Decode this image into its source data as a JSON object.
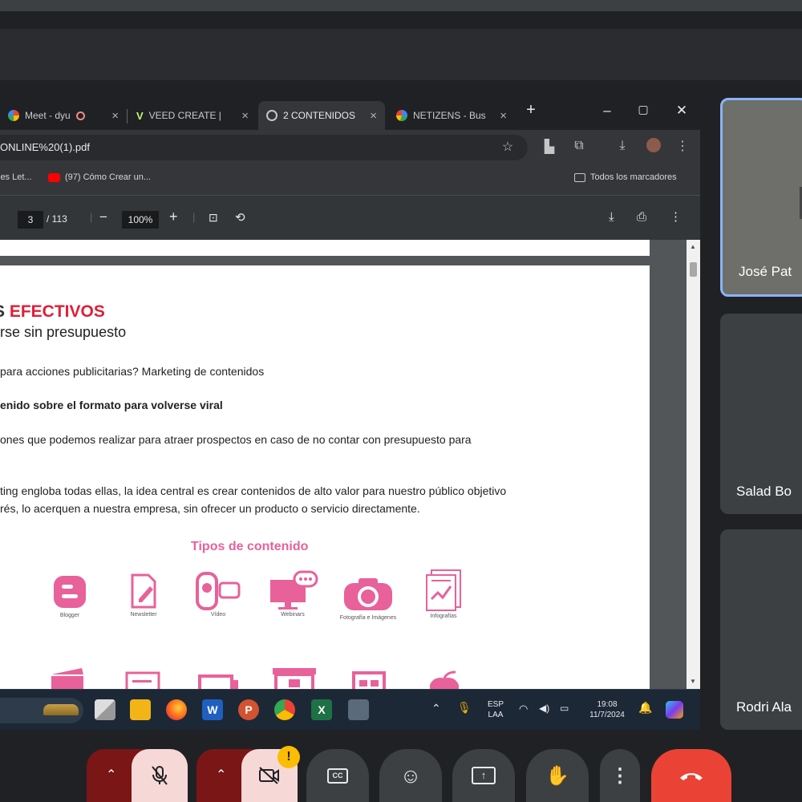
{
  "tabs": [
    {
      "title": "Meet - dyu",
      "favicon": "meet-icon"
    },
    {
      "title": "VEED CREATE |",
      "favicon": "veed-icon"
    },
    {
      "title": "2 CONTENIDOS",
      "favicon": "globe-icon",
      "active": true
    },
    {
      "title": "NETIZENS - Bus",
      "favicon": "google-icon"
    }
  ],
  "address": {
    "url": "ONLINE%20(1).pdf"
  },
  "bookmarks": {
    "left": "les Let...",
    "youtube": "(97) Cómo Crear un...",
    "all": "Todos los marcadores"
  },
  "pdf": {
    "page": "3",
    "total": "/ 113",
    "zoom": "100%"
  },
  "doc": {
    "heading_first": "S ",
    "heading_rest": "EFECTIVOS",
    "subheading": "rse sin presupuesto",
    "line1": "para acciones publicitarias? Marketing de contenidos",
    "line2": "enido sobre el formato para volverse viral",
    "line3": "ones que podemos realizar para atraer prospectos en caso de no contar con presupuesto para",
    "line4": "ting engloba todas ellas, la idea central es crear contenidos de alto valor para nuestro público objetivo",
    "line5": "rés, lo acerquen a nuestra empresa, sin ofrecer un producto o servicio directamente.",
    "types_title": "Tipos de contenido",
    "types": [
      "Blogger",
      "Newsletter",
      "Vídeo",
      "Webinars",
      "Fotografía e Imágenes",
      "Infografías"
    ]
  },
  "taskbar": {
    "lang1": "ESP",
    "lang2": "LAA",
    "time": "19:08",
    "date": "11/7/2024"
  },
  "participants": [
    {
      "name": "José Pat"
    },
    {
      "name": "Salad Bo"
    },
    {
      "name": "Rodri Ala"
    }
  ],
  "controls": {
    "alert": "!"
  },
  "colors": {
    "accent": "#e01e37",
    "pink": "#e8619a",
    "end_call": "#ea4335"
  }
}
